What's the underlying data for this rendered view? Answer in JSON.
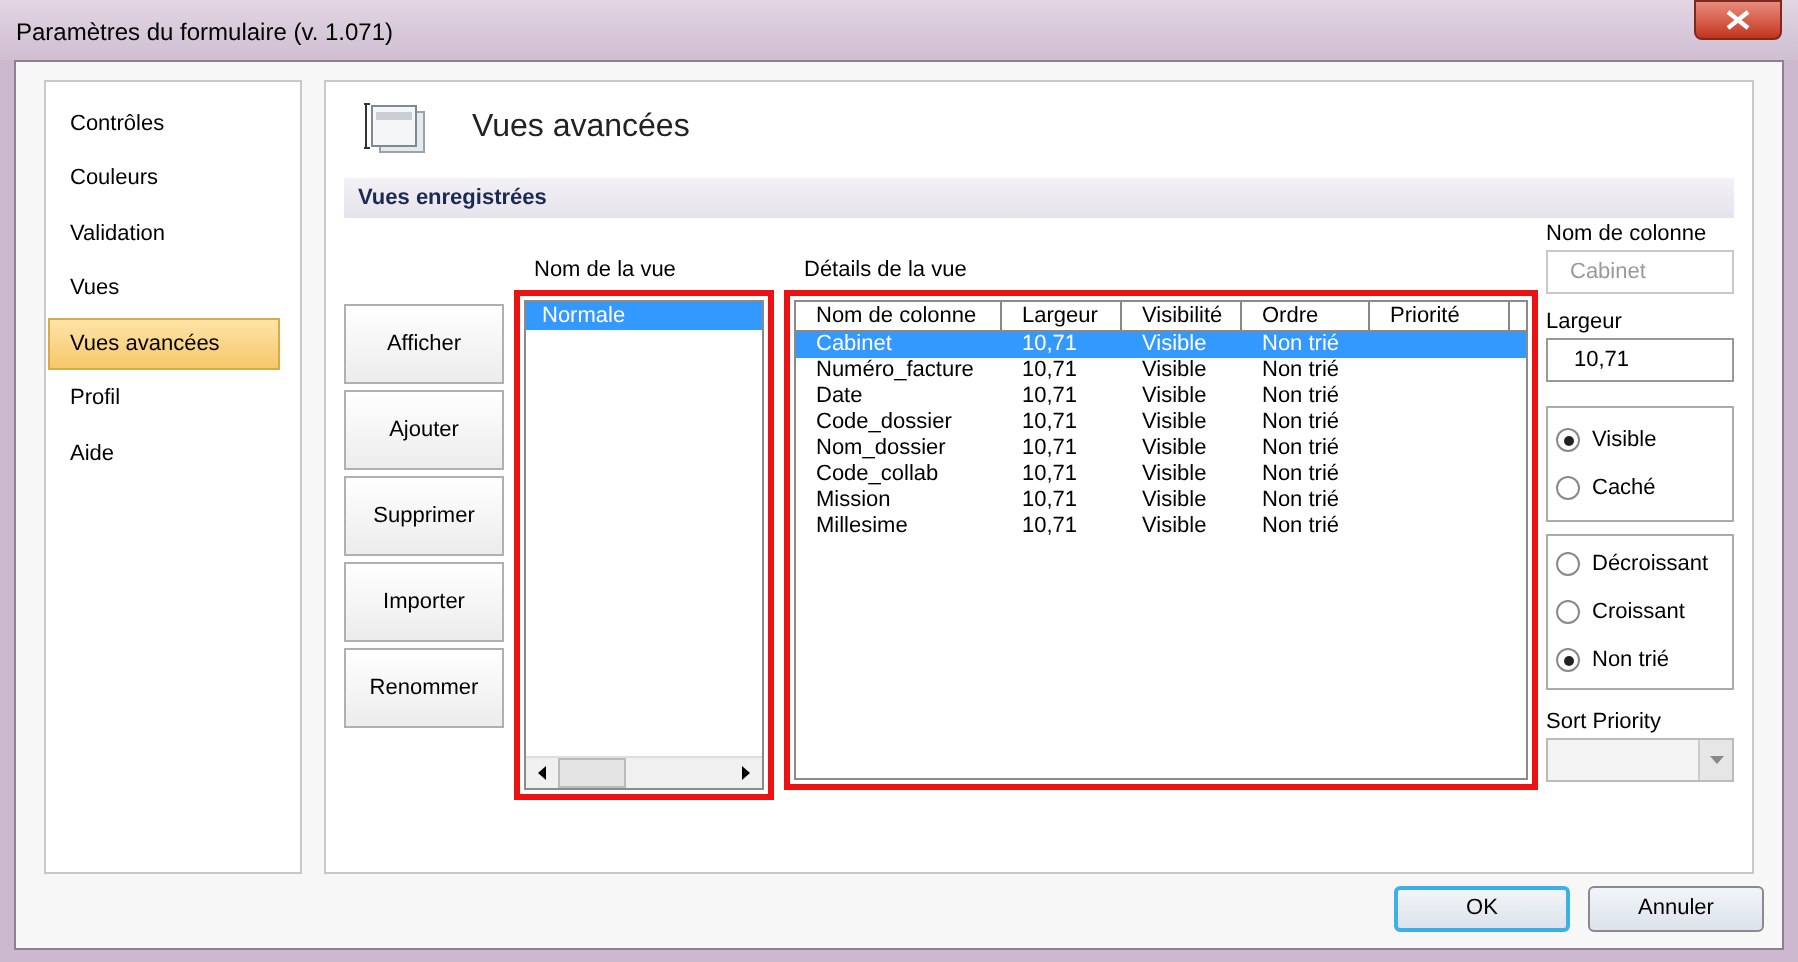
{
  "window": {
    "title": "Paramètres du formulaire (v. 1.071)"
  },
  "sidebar": {
    "items": [
      {
        "label": "Contrôles",
        "selected": false
      },
      {
        "label": "Couleurs",
        "selected": false
      },
      {
        "label": "Validation",
        "selected": false
      },
      {
        "label": "Vues",
        "selected": false
      },
      {
        "label": "Vues avancées",
        "selected": true
      },
      {
        "label": "Profil",
        "selected": false
      },
      {
        "label": "Aide",
        "selected": false
      }
    ]
  },
  "page": {
    "title": "Vues avancées",
    "section": "Vues enregistrées"
  },
  "actions": [
    "Afficher",
    "Ajouter",
    "Supprimer",
    "Importer",
    "Renommer"
  ],
  "views": {
    "label": "Nom de la vue",
    "items": [
      {
        "name": "Normale",
        "selected": true
      }
    ]
  },
  "details": {
    "label": "Détails de la vue",
    "columns": [
      "Nom de colonne",
      "Largeur",
      "Visibilité",
      "Ordre",
      "Priorité"
    ],
    "rows": [
      {
        "cells": [
          "Cabinet",
          "10,71",
          "Visible",
          "Non trié"
        ],
        "selected": true
      },
      {
        "cells": [
          "Numéro_facture",
          "10,71",
          "Visible",
          "Non trié"
        ],
        "selected": false
      },
      {
        "cells": [
          "Date",
          "10,71",
          "Visible",
          "Non trié"
        ],
        "selected": false
      },
      {
        "cells": [
          "Code_dossier",
          "10,71",
          "Visible",
          "Non trié"
        ],
        "selected": false
      },
      {
        "cells": [
          "Nom_dossier",
          "10,71",
          "Visible",
          "Non trié"
        ],
        "selected": false
      },
      {
        "cells": [
          "Code_collab",
          "10,71",
          "Visible",
          "Non trié"
        ],
        "selected": false
      },
      {
        "cells": [
          "Mission",
          "10,71",
          "Visible",
          "Non trié"
        ],
        "selected": false
      },
      {
        "cells": [
          "Millesime",
          "10,71",
          "Visible",
          "Non trié"
        ],
        "selected": false
      }
    ]
  },
  "column_props": {
    "name_label": "Nom de colonne",
    "name_value": "Cabinet",
    "width_label": "Largeur",
    "width_value": "10,71",
    "visibility": [
      {
        "label": "Visible",
        "selected": true
      },
      {
        "label": "Caché",
        "selected": false
      }
    ],
    "sort": [
      {
        "label": "Décroissant",
        "selected": false
      },
      {
        "label": "Croissant",
        "selected": false
      },
      {
        "label": "Non trié",
        "selected": true
      }
    ],
    "priority_label": "Sort Priority"
  },
  "footer": [
    {
      "label": "OK",
      "default": true
    },
    {
      "label": "Annuler",
      "default": false
    }
  ]
}
